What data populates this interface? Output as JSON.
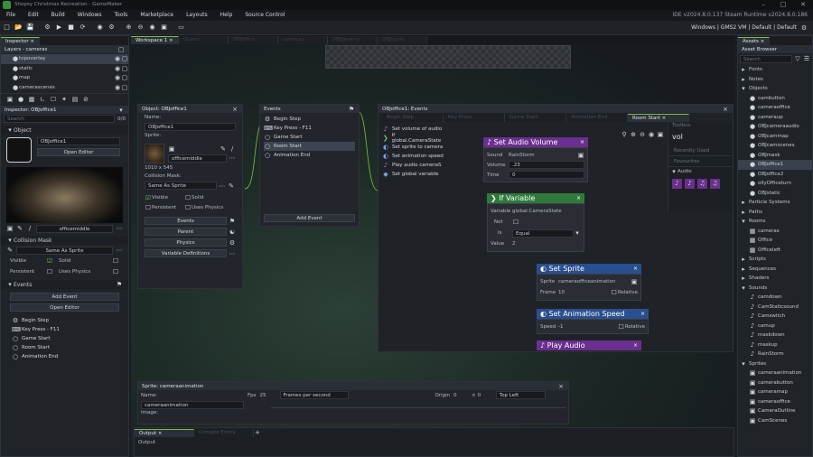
{
  "window": {
    "title": "Shopsy Christmas Recreation - GameMaker",
    "version": "IDE v2024.8.0.137 Steam  Runtime v2024.8.0.186"
  },
  "menu": [
    "File",
    "Edit",
    "Build",
    "Windows",
    "Tools",
    "Marketplace",
    "Layouts",
    "Help",
    "Source Control"
  ],
  "target": {
    "platform": "Windows",
    "vm": "GMS2 VM",
    "config1": "Default",
    "config2": "Default"
  },
  "inspector": {
    "tab": "Inspector",
    "layers_header": "Layers - cameras",
    "layers": [
      "topoverlay",
      "static",
      "map",
      "camerascenes"
    ],
    "inspector2": "Inspector: OBJoffice1",
    "search_placeholder": "Search",
    "search_count": "0/0",
    "object_section": "Object",
    "object_name": "OBJoffice1",
    "open_editor": "Open Editor",
    "sprite_name": "officemiddle",
    "collision_section": "Collision Mask",
    "collision_value": "Same As Sprite",
    "visible": "Visible",
    "solid": "Solid",
    "persistent": "Persistent",
    "uses_physics": "Uses Physics",
    "events_section": "Events",
    "add_event": "Add Event",
    "open_editor2": "Open Editor",
    "events": [
      "Begin Step",
      "Key Press - F11",
      "Game Start",
      "Room Start",
      "Animation End"
    ]
  },
  "workspace": {
    "tabs": [
      "Workspace 1",
      "Object",
      "OBJoffice",
      "cameraa",
      "OBJgeneral",
      "OBJaudio"
    ]
  },
  "object_panel": {
    "title": "Object: OBJoffice1",
    "name_label": "Name:",
    "name": "OBJoffice1",
    "sprite_label": "Sprite:",
    "sprite": "officemiddle",
    "size": "1010 x 545",
    "mask_label": "Collision Mask:",
    "mask": "Same As Sprite",
    "visible": "Visible",
    "solid": "Solid",
    "persistent": "Persistent",
    "uses_physics": "Uses Physics",
    "btn_events": "Events",
    "btn_parent": "Parent",
    "btn_physics": "Physics",
    "btn_vardefs": "Variable Definitions"
  },
  "events_panel": {
    "title": "Events",
    "items": [
      "Begin Step",
      "Key Press - F11",
      "Game Start",
      "Room Start",
      "Animation End"
    ],
    "add_event": "Add Event"
  },
  "code_panel": {
    "title": "OBJoffice1: Events",
    "tabs": [
      "Begin Step",
      "Key Press",
      "Game Start",
      "Animation End",
      "Room Start"
    ],
    "list": [
      "Set volume of audio",
      "If global.CameraState",
      "Set sprite to camera",
      "Set animation speed",
      "Play audio cameraS",
      "Set global variable"
    ],
    "nodes": {
      "audio": {
        "title": "Set Audio Volume",
        "sound_label": "Sound",
        "sound": "RainStorm",
        "volume_label": "Volume",
        "volume": ".23",
        "time_label": "Time",
        "time": "0"
      },
      "ifvar": {
        "title": "If Variable",
        "var_label": "Variable",
        "var": "global.CameraState",
        "not_label": "Not",
        "is_label": "Is",
        "is": "Equal",
        "value_label": "Value",
        "value": "2"
      },
      "sprite": {
        "title": "Set Sprite",
        "sprite_label": "Sprite",
        "sprite": "cameraofficeanimation",
        "frame_label": "Frame",
        "frame": "10",
        "relative": "Relative"
      },
      "anim": {
        "title": "Set Animation Speed",
        "speed_label": "Speed",
        "speed": "-1",
        "relative": "Relative"
      },
      "play": {
        "title": "Play Audio"
      }
    },
    "toolbox": {
      "label": "Toolbox",
      "search": "vol",
      "recent": "Recently Used",
      "favourites": "Favourites",
      "audio": "Audio"
    }
  },
  "sprite_panel": {
    "title": "Sprite: cameraanimation",
    "name_label": "Name:",
    "name": "cameraanimation",
    "image_label": "Image:",
    "fps_label": "Fps",
    "fps": "25",
    "fps_mode": "Frames per second",
    "origin_label": "Origin",
    "origin_x": "0",
    "origin_y": "0",
    "origin_mode": "Top Left"
  },
  "output": {
    "tabs": [
      "Output",
      "Compile Errors"
    ],
    "label": "Output"
  },
  "assets": {
    "tab": "Assets",
    "title": "Asset Browser",
    "search": "Search",
    "items": [
      {
        "t": "Fonts",
        "l": 0,
        "k": "folder"
      },
      {
        "t": "Notes",
        "l": 0,
        "k": "folder"
      },
      {
        "t": "Objects",
        "l": 0,
        "k": "folder-open"
      },
      {
        "t": "cambutton",
        "l": 1,
        "k": "dot"
      },
      {
        "t": "cameraoffice",
        "l": 1,
        "k": "dot"
      },
      {
        "t": "cameraup",
        "l": 1,
        "k": "dot"
      },
      {
        "t": "OBJcameraaudio",
        "l": 1,
        "k": "dot"
      },
      {
        "t": "OBJcammap",
        "l": 1,
        "k": "dot"
      },
      {
        "t": "OBJcamscenes",
        "l": 1,
        "k": "dot"
      },
      {
        "t": "OBJmask",
        "l": 1,
        "k": "dot"
      },
      {
        "t": "OBJoffice1",
        "l": 1,
        "k": "dot-sel"
      },
      {
        "t": "OBJoffice2",
        "l": 1,
        "k": "dot"
      },
      {
        "t": "ollyOfficeturn",
        "l": 1,
        "k": "dot"
      },
      {
        "t": "OBJstatic",
        "l": 1,
        "k": "dot"
      },
      {
        "t": "Particle Systems",
        "l": 0,
        "k": "folder"
      },
      {
        "t": "Paths",
        "l": 0,
        "k": "folder"
      },
      {
        "t": "Rooms",
        "l": 0,
        "k": "folder-open"
      },
      {
        "t": "cameras",
        "l": 1,
        "k": "room"
      },
      {
        "t": "Office",
        "l": 1,
        "k": "room"
      },
      {
        "t": "Officeleft",
        "l": 1,
        "k": "room"
      },
      {
        "t": "Scripts",
        "l": 0,
        "k": "folder"
      },
      {
        "t": "Sequences",
        "l": 0,
        "k": "folder"
      },
      {
        "t": "Shaders",
        "l": 0,
        "k": "folder"
      },
      {
        "t": "Sounds",
        "l": 0,
        "k": "folder-open"
      },
      {
        "t": "camdown",
        "l": 1,
        "k": "sound"
      },
      {
        "t": "CamStaticsound",
        "l": 1,
        "k": "sound"
      },
      {
        "t": "Camswitch",
        "l": 1,
        "k": "sound"
      },
      {
        "t": "camup",
        "l": 1,
        "k": "sound"
      },
      {
        "t": "maskdown",
        "l": 1,
        "k": "sound"
      },
      {
        "t": "maskup",
        "l": 1,
        "k": "sound"
      },
      {
        "t": "RainStorm",
        "l": 1,
        "k": "sound"
      },
      {
        "t": "Sprites",
        "l": 0,
        "k": "folder-open"
      },
      {
        "t": "cameraanimation",
        "l": 1,
        "k": "sprite"
      },
      {
        "t": "camerabutton",
        "l": 1,
        "k": "sprite"
      },
      {
        "t": "cameramap",
        "l": 1,
        "k": "sprite"
      },
      {
        "t": "cameraoffice",
        "l": 1,
        "k": "sprite"
      },
      {
        "t": "CameraOutline",
        "l": 1,
        "k": "sprite"
      },
      {
        "t": "CamScenes",
        "l": 1,
        "k": "sprite"
      }
    ]
  },
  "colors": {
    "audio_node": "#6b2f8f",
    "if_node": "#2f7a3a",
    "sprite_node": "#2a4f8f",
    "accent": "#7fbf4a"
  }
}
